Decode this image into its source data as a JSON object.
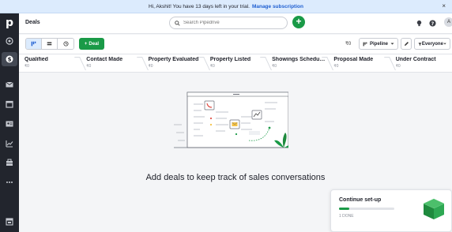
{
  "banner": {
    "text": "Hi, Akshit! You have 13 days left in your trial.",
    "link": "Manage subscription",
    "close": "×"
  },
  "topbar": {
    "title": "Deals",
    "search_placeholder": "Search Pipedrive",
    "add_label": "+",
    "avatar_initial": "A"
  },
  "toolbar": {
    "add_deal_label": "Deal",
    "total_amount": "₹0",
    "pipeline_label": "Pipeline",
    "owner_label": "Everyone"
  },
  "stages": [
    {
      "name": "Qualified",
      "amount": "₹0"
    },
    {
      "name": "Contact Made",
      "amount": "₹0"
    },
    {
      "name": "Property Evaluated",
      "amount": "₹0"
    },
    {
      "name": "Property Listed",
      "amount": "₹0"
    },
    {
      "name": "Showings Schedu…",
      "amount": "₹0"
    },
    {
      "name": "Proposal Made",
      "amount": "₹0"
    },
    {
      "name": "Under Contract",
      "amount": "₹0"
    }
  ],
  "empty_state": {
    "title": "Add deals to keep track of sales conversations"
  },
  "setup_card": {
    "title": "Continue set-up",
    "meta": "1 DONE",
    "progress": 0.18
  },
  "colors": {
    "accent": "#1a9a47",
    "sidebar": "#22252d",
    "banner": "#dcebfd",
    "link": "#1f5fd1"
  },
  "icons": [
    "pipedrive-logo",
    "target-icon",
    "deals-icon",
    "mail-icon",
    "calendar-icon",
    "contacts-icon",
    "chart-icon",
    "products-icon",
    "more-icon",
    "marketplace-icon",
    "search-icon",
    "bulb-icon",
    "help-icon",
    "kanban-icon",
    "list-icon",
    "forecast-icon",
    "pencil-icon",
    "filter-icon"
  ]
}
